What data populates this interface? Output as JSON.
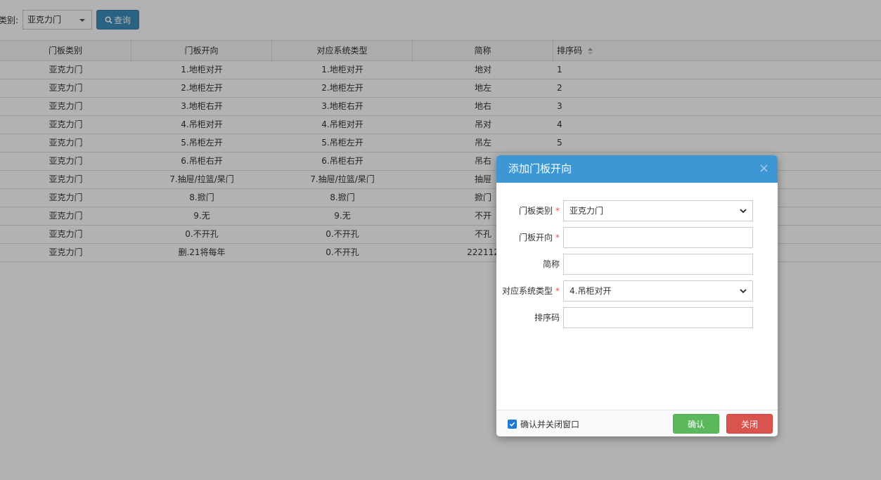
{
  "filter": {
    "label": "类别:",
    "category_value": "亚克力门",
    "query_label": "查询"
  },
  "table": {
    "headers": [
      "门板类别",
      "门板开向",
      "对应系统类型",
      "简称",
      "排序码"
    ],
    "rows": [
      [
        "亚克力门",
        "1.地柜对开",
        "1.地柜对开",
        "地对",
        "1"
      ],
      [
        "亚克力门",
        "2.地柜左开",
        "2.地柜左开",
        "地左",
        "2"
      ],
      [
        "亚克力门",
        "3.地柜右开",
        "3.地柜右开",
        "地右",
        "3"
      ],
      [
        "亚克力门",
        "4.吊柜对开",
        "4.吊柜对开",
        "吊对",
        "4"
      ],
      [
        "亚克力门",
        "5.吊柜左开",
        "5.吊柜左开",
        "吊左",
        "5"
      ],
      [
        "亚克力门",
        "6.吊柜右开",
        "6.吊柜右开",
        "吊右",
        ""
      ],
      [
        "亚克力门",
        "7.抽屉/拉篮/杲门",
        "7.抽屉/拉篮/杲门",
        "抽屉",
        ""
      ],
      [
        "亚克力门",
        "8.掀门",
        "8.掀门",
        "掀门",
        ""
      ],
      [
        "亚克力门",
        "9.无",
        "9.无",
        "不开",
        ""
      ],
      [
        "亚克力门",
        "0.不开孔",
        "0.不开孔",
        "不孔",
        ""
      ],
      [
        "亚克力门",
        "删.21将每年",
        "0.不开孔",
        "222112",
        ""
      ]
    ]
  },
  "dialog": {
    "title": "添加门板开向",
    "close_symbol": "×",
    "fields": {
      "category": {
        "label": "门板类别",
        "required_mark": "*",
        "value": "亚克力门"
      },
      "direction": {
        "label": "门板开向",
        "required_mark": "*",
        "value": ""
      },
      "short_name": {
        "label": "简称",
        "value": ""
      },
      "system_type": {
        "label": "对应系统类型",
        "required_mark": "*",
        "value": "4.吊柜对开"
      },
      "sort_code": {
        "label": "排序码",
        "value": ""
      }
    },
    "checkbox_label": "确认并关闭窗口",
    "confirm_label": "确认",
    "close_label": "关闭"
  },
  "colors": {
    "primary": "#3c8dbc",
    "dialog_header": "#3c97d4",
    "success": "#5cb85c",
    "danger": "#d9534f"
  }
}
